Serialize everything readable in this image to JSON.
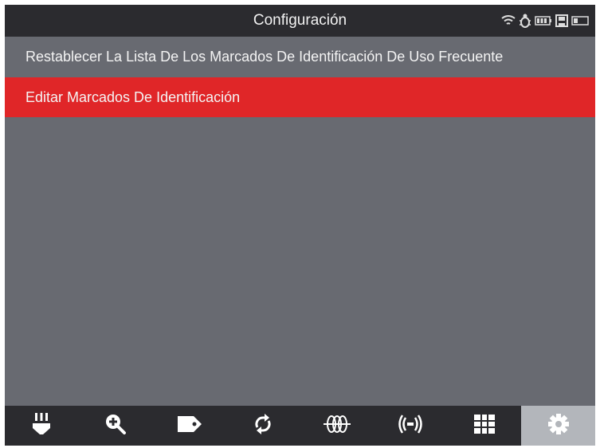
{
  "header": {
    "title": "Configuración",
    "status_icons": [
      "wifi-icon",
      "bug-icon",
      "battery-icon",
      "save-icon",
      "display-icon"
    ]
  },
  "menu": {
    "items": [
      {
        "label": "Restablecer La Lista De Los Marcados De Identificación De Uso Frecuente",
        "selected": false
      },
      {
        "label": "Editar Marcados De Identificación",
        "selected": true
      }
    ]
  },
  "toolbar": {
    "buttons": [
      {
        "icon": "connector-icon",
        "active": false
      },
      {
        "icon": "zoom-in-icon",
        "active": false
      },
      {
        "icon": "tag-icon",
        "active": false
      },
      {
        "icon": "refresh-icon",
        "active": false
      },
      {
        "icon": "sensor-icon",
        "active": false
      },
      {
        "icon": "signal-icon",
        "active": false
      },
      {
        "icon": "grid-icon",
        "active": false
      },
      {
        "icon": "gear-icon",
        "active": true
      }
    ]
  },
  "colors": {
    "title_bar": "#2b2b2f",
    "screen_bg": "#686a71",
    "selected_item": "#e02628",
    "toolbar_active": "#b3b6bb",
    "text": "#f4f4f4"
  }
}
